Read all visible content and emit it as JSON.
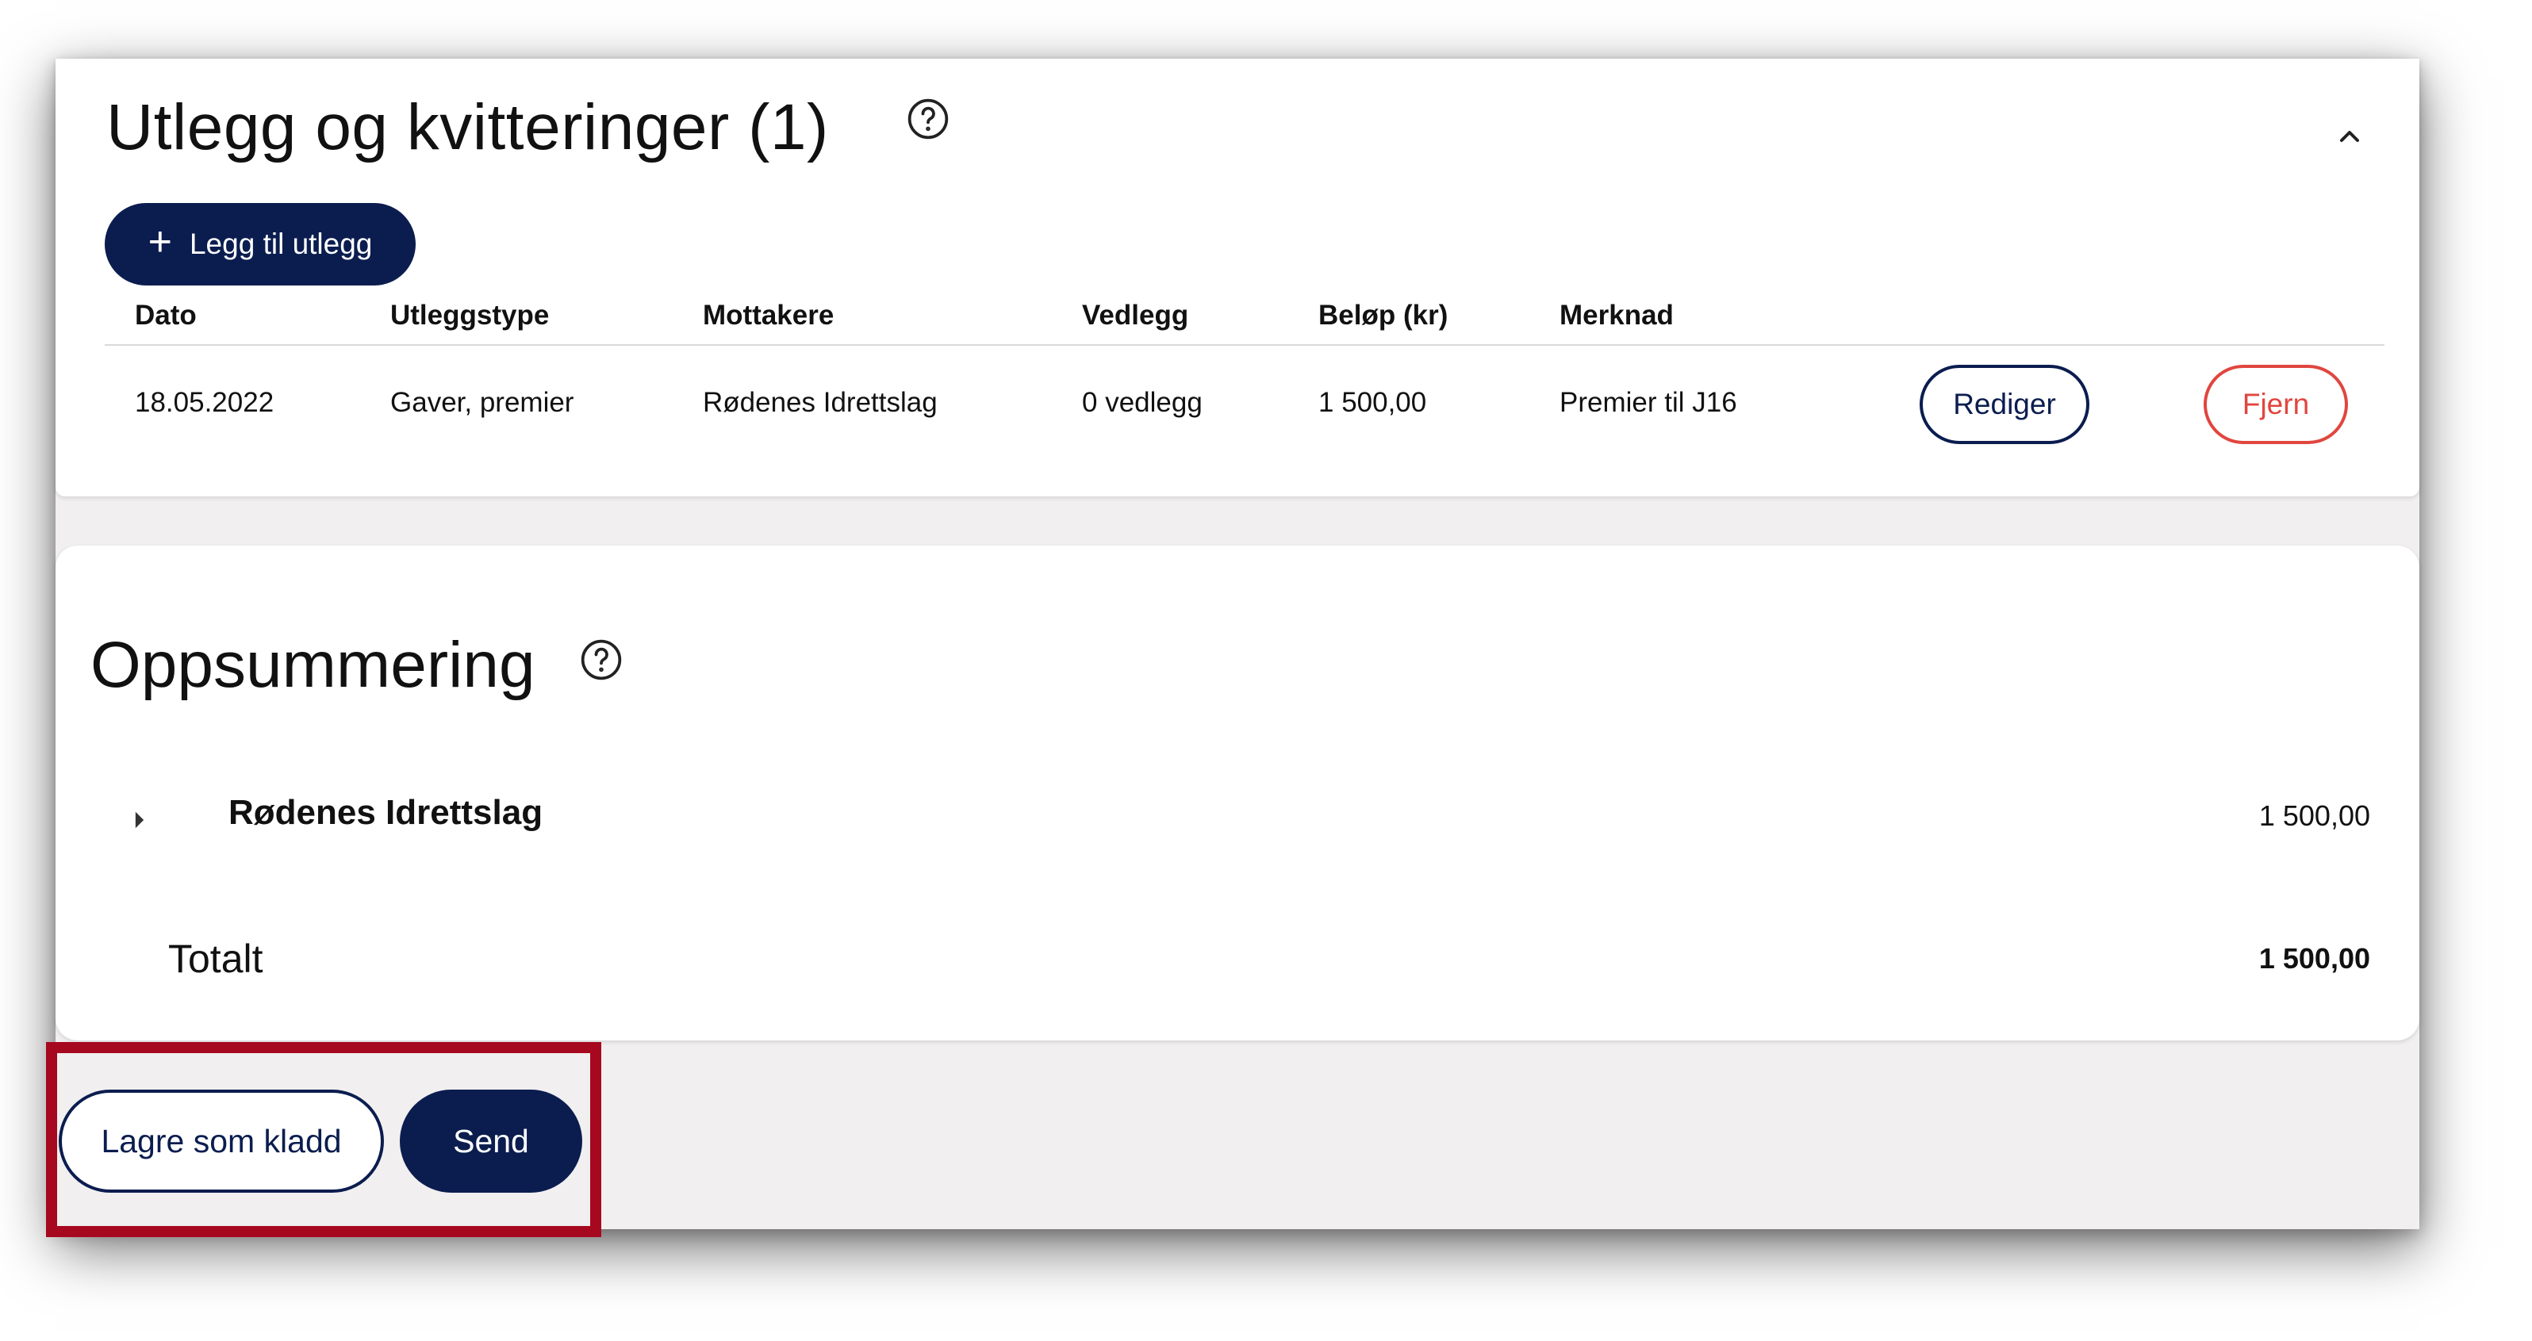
{
  "expenses": {
    "title": "Utlegg og kvitteringer (1)",
    "help_icon": "help-circle-icon",
    "collapse_icon": "chevron-up-icon",
    "add_button_label": "Legg til utlegg",
    "add_icon": "plus-icon",
    "columns": {
      "date": "Dato",
      "type": "Utleggstype",
      "recipients": "Mottakere",
      "attachments": "Vedlegg",
      "amount": "Beløp (kr)",
      "note": "Merknad"
    },
    "rows": [
      {
        "date": "18.05.2022",
        "type": "Gaver, premier",
        "recipients": "Rødenes Idrettslag",
        "attachments": "0 vedlegg",
        "amount": "1 500,00",
        "note": "Premier til J16",
        "edit_label": "Rediger",
        "remove_label": "Fjern"
      }
    ]
  },
  "summary": {
    "title": "Oppsummering",
    "help_icon": "help-circle-icon",
    "expander_icon": "caret-right-icon",
    "groups": [
      {
        "name": "Rødenes Idrettslag",
        "amount": "1 500,00"
      }
    ],
    "total_label": "Totalt",
    "total_amount": "1 500,00"
  },
  "actions": {
    "draft_label": "Lagre som kladd",
    "send_label": "Send"
  },
  "colors": {
    "primary": "#0b1d4f",
    "danger": "#e0463f",
    "highlight": "#a6081f",
    "background": "#f1eff0"
  }
}
